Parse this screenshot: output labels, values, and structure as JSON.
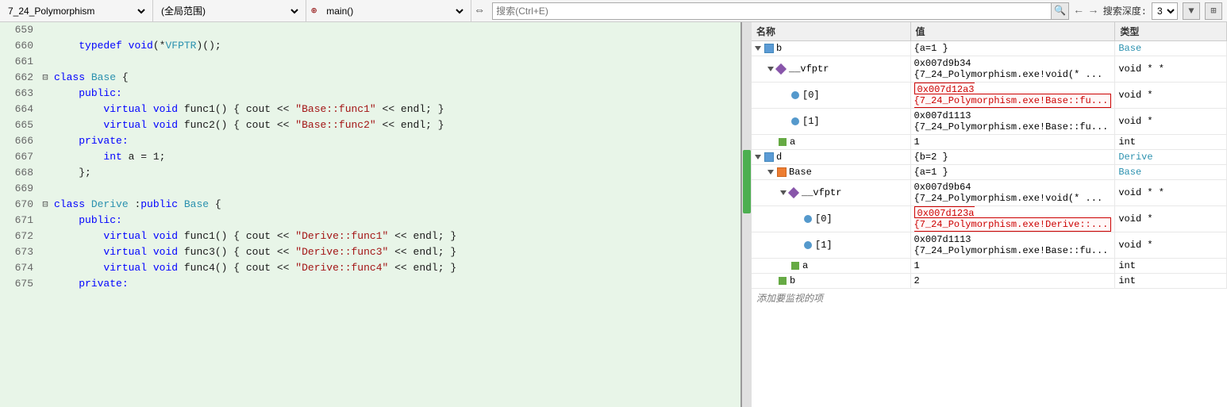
{
  "toolbar": {
    "file_dropdown": "7_24_Polymorphism",
    "scope_dropdown": "(全局范围)",
    "function_dropdown": "main()",
    "search_placeholder": "搜索(Ctrl+E)",
    "nav_back": "←",
    "nav_forward": "→",
    "depth_label": "搜索深度:",
    "depth_value": "3",
    "icon_filter": "▼",
    "icon_refresh": "⟳"
  },
  "watch_panel": {
    "col_name": "名称",
    "col_value": "值",
    "col_type": "类型",
    "add_watch_label": "添加要监视的项",
    "rows": [
      {
        "level": 0,
        "expand": "down",
        "icon": "cube",
        "name": "b",
        "value": "{a=1 }",
        "type": "Base",
        "highlighted": false
      },
      {
        "level": 1,
        "expand": "down",
        "icon": "diamond",
        "name": "__vfptr",
        "value": "0x007d9b34 {7_24_Polymorphism.exe!void(* ...",
        "type": "void * *",
        "highlighted": false
      },
      {
        "level": 2,
        "expand": "none",
        "icon": "circle",
        "name": "[0]",
        "value": "0x007d12a3 {7_24_Polymorphism.exe!Base::fu...",
        "type": "void *",
        "highlighted": true
      },
      {
        "level": 2,
        "expand": "none",
        "icon": "circle",
        "name": "[1]",
        "value": "0x007d1113 {7_24_Polymorphism.exe!Base::fu...",
        "type": "void *",
        "highlighted": false
      },
      {
        "level": 1,
        "expand": "none",
        "icon": "square",
        "name": "a",
        "value": "1",
        "type": "int",
        "highlighted": false
      },
      {
        "level": 0,
        "expand": "down",
        "icon": "cube",
        "name": "d",
        "value": "{b=2 }",
        "type": "Derive",
        "highlighted": false
      },
      {
        "level": 1,
        "expand": "down",
        "icon": "cube-orange",
        "name": "Base",
        "value": "{a=1 }",
        "type": "Base",
        "highlighted": false
      },
      {
        "level": 2,
        "expand": "down",
        "icon": "diamond",
        "name": "__vfptr",
        "value": "0x007d9b64 {7_24_Polymorphism.exe!void(* ...",
        "type": "void * *",
        "highlighted": false
      },
      {
        "level": 3,
        "expand": "none",
        "icon": "circle",
        "name": "[0]",
        "value": "0x007d123a {7_24_Polymorphism.exe!Derive::...",
        "type": "void *",
        "highlighted": true
      },
      {
        "level": 3,
        "expand": "none",
        "icon": "circle",
        "name": "[1]",
        "value": "0x007d1113 {7_24_Polymorphism.exe!Base::fu...",
        "type": "void *",
        "highlighted": false
      },
      {
        "level": 2,
        "expand": "none",
        "icon": "square",
        "name": "a",
        "value": "1",
        "type": "int",
        "highlighted": false
      },
      {
        "level": 1,
        "expand": "none",
        "icon": "square",
        "name": "b",
        "value": "2",
        "type": "int",
        "highlighted": false
      }
    ]
  },
  "code": {
    "lines": [
      {
        "num": 659,
        "indent": 0,
        "collapse": false,
        "html_key": "line659"
      },
      {
        "num": 660,
        "indent": 1,
        "collapse": false,
        "html_key": "line660"
      },
      {
        "num": 661,
        "indent": 0,
        "collapse": false,
        "html_key": "line661"
      },
      {
        "num": 662,
        "indent": 0,
        "collapse": true,
        "html_key": "line662"
      },
      {
        "num": 663,
        "indent": 1,
        "collapse": false,
        "html_key": "line663"
      },
      {
        "num": 664,
        "indent": 2,
        "collapse": false,
        "html_key": "line664"
      },
      {
        "num": 665,
        "indent": 2,
        "collapse": false,
        "html_key": "line665"
      },
      {
        "num": 666,
        "indent": 1,
        "collapse": false,
        "html_key": "line666"
      },
      {
        "num": 667,
        "indent": 2,
        "collapse": false,
        "html_key": "line667"
      },
      {
        "num": 668,
        "indent": 1,
        "collapse": false,
        "html_key": "line668"
      },
      {
        "num": 669,
        "indent": 0,
        "collapse": false,
        "html_key": "line669"
      },
      {
        "num": 670,
        "indent": 0,
        "collapse": true,
        "html_key": "line670"
      },
      {
        "num": 671,
        "indent": 1,
        "collapse": false,
        "html_key": "line671"
      },
      {
        "num": 672,
        "indent": 2,
        "collapse": false,
        "html_key": "line672"
      },
      {
        "num": 673,
        "indent": 2,
        "collapse": false,
        "html_key": "line673"
      },
      {
        "num": 674,
        "indent": 2,
        "collapse": false,
        "html_key": "line674"
      },
      {
        "num": 675,
        "indent": 1,
        "collapse": false,
        "html_key": "line675"
      }
    ]
  }
}
